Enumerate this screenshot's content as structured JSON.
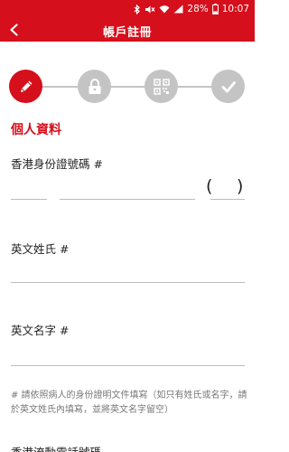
{
  "status": {
    "battery": "28%",
    "time": "10:07"
  },
  "header": {
    "title": "帳戶註冊"
  },
  "steps": [
    {
      "name": "personal-info",
      "icon": "pencil-icon",
      "active": true
    },
    {
      "name": "security",
      "icon": "lock-icon",
      "active": false
    },
    {
      "name": "qr-code",
      "icon": "qr-code-icon",
      "active": false
    },
    {
      "name": "complete",
      "icon": "check-icon",
      "active": false
    }
  ],
  "form": {
    "section_title": "個人資料",
    "hkid_label": "香港身份證號碼 #",
    "hkid_open_paren": "(",
    "hkid_close_paren": ")",
    "surname_label": "英文姓氏 #",
    "given_name_label": "英文名字 #",
    "hint": "# 請依照病人的身份證明文件填寫（如只有姓氏或名字，請於英文姓氏內填寫，並將英文名字留空）",
    "mobile_label": "香港流動電話號碼"
  },
  "colors": {
    "brand": "#d50f1b",
    "inactive_step": "#c4c4c4"
  }
}
